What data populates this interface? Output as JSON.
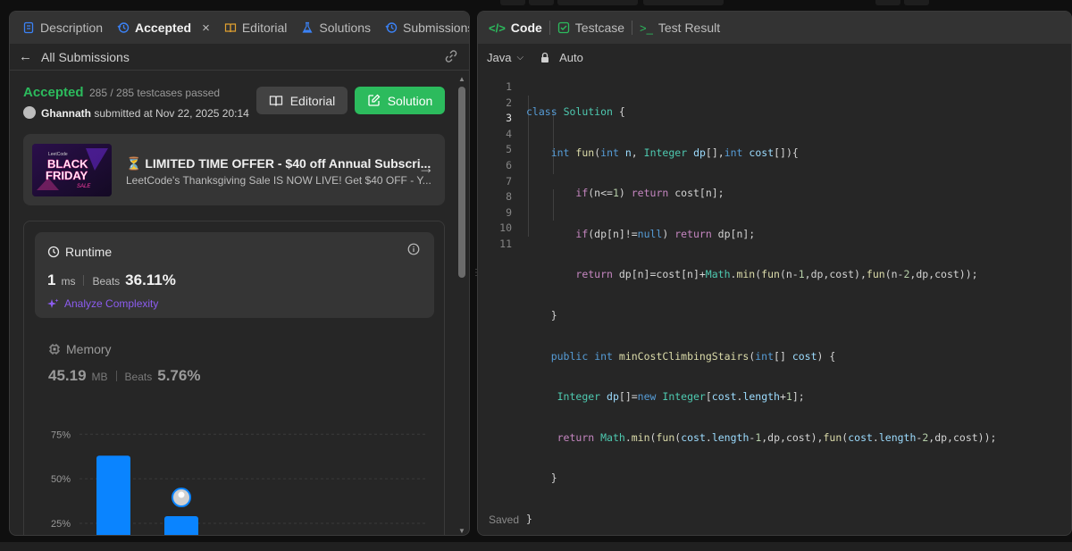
{
  "left_panel": {
    "tabs": [
      {
        "label": "Description",
        "icon": "document-icon"
      },
      {
        "label": "Accepted",
        "icon": "history-icon",
        "close": "×"
      },
      {
        "label": "Editorial",
        "icon": "book-icon"
      },
      {
        "label": "Solutions",
        "icon": "flask-icon"
      },
      {
        "label": "Submissions",
        "icon": "history-icon"
      }
    ],
    "back_label": "All Submissions",
    "result": {
      "status": "Accepted",
      "testcases": "285 / 285 testcases passed",
      "user": "Ghannath",
      "submitted_text": "submitted at Nov 22, 2025 20:14"
    },
    "buttons": {
      "editorial": "Editorial",
      "solution": "Solution"
    },
    "promo": {
      "badge_top": "LeetCode",
      "badge_line1": "BLACK",
      "badge_line2": "FRIDAY",
      "badge_line3": "SALE",
      "title": "⏳ LIMITED TIME OFFER - $40 off Annual Subscri...",
      "description": "LeetCode's Thanksgiving Sale IS NOW LIVE! Get $40 OFF - Y..."
    },
    "runtime": {
      "label": "Runtime",
      "value": "1",
      "unit": "ms",
      "beats_label": "Beats",
      "beats_value": "36.11%",
      "analyze": "Analyze Complexity"
    },
    "memory": {
      "label": "Memory",
      "value": "45.19",
      "unit": "MB",
      "beats_label": "Beats",
      "beats_value": "5.76%"
    },
    "chart_data": {
      "type": "bar",
      "ytick_labels": [
        "75%",
        "50%",
        "25%"
      ],
      "ylim": [
        0,
        85
      ],
      "values": [
        63,
        29
      ],
      "highlight_index": 1,
      "colors": {
        "bar": "#0a84ff"
      }
    }
  },
  "right_panel": {
    "tabs": [
      {
        "label": "Code",
        "icon": "code-icon"
      },
      {
        "label": "Testcase",
        "icon": "checkbox-icon"
      },
      {
        "label": "Test Result",
        "icon": "terminal-icon"
      }
    ],
    "language": "Java",
    "mode": "Auto",
    "line_numbers": [
      "1",
      "2",
      "3",
      "4",
      "5",
      "6",
      "7",
      "8",
      "9",
      "10",
      "11"
    ],
    "current_line": "3",
    "status": "Saved"
  }
}
